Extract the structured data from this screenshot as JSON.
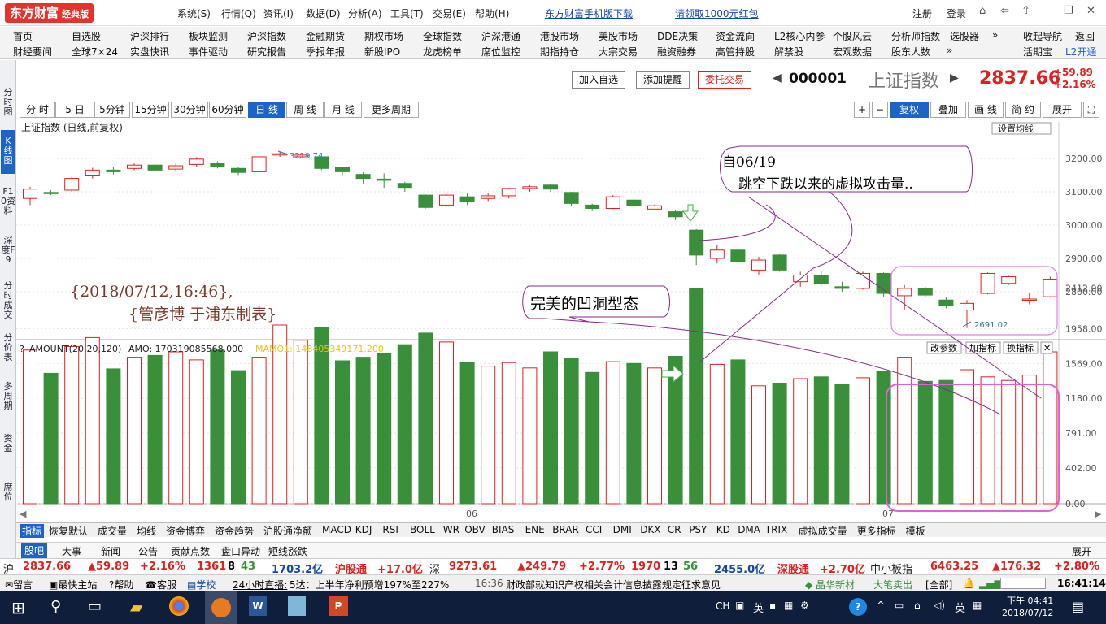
{
  "app": {
    "logo": "东方财富",
    "edition": "经典版"
  },
  "menu": [
    "系统(S)",
    "行情(Q)",
    "资讯(I)",
    "数据(D)",
    "分析(A)",
    "工具(T)",
    "交易(E)",
    "帮助(H)"
  ],
  "promos": [
    "东方财富手机版下载",
    "请领取1000元红包"
  ],
  "account": {
    "register": "注册",
    "login": "登录"
  },
  "nav_row1": [
    "首页",
    "自选股",
    "沪深排行",
    "板块监测",
    "沪深指数",
    "金融期货",
    "期权市场",
    "全球指数",
    "沪深港通",
    "港股市场",
    "美股市场",
    "DDE决策",
    "资金流向",
    "L2核心内参",
    "个股风云",
    "分析师指数",
    "选股器",
    "»",
    "收起导航",
    "返回"
  ],
  "nav_row2": [
    "财经要闻",
    "全球7×24",
    "实盘快讯",
    "事件驱动",
    "研究报告",
    "季报年报",
    "新股IPO",
    "龙虎榜单",
    "席位监控",
    "期指持仓",
    "大宗交易",
    "融资融券",
    "高管持股",
    "解禁股",
    "宏观数据",
    "股东人数",
    "»",
    "活期宝",
    "L2开通"
  ],
  "left_tabs": [
    "分时图",
    "K线图",
    "F10资料",
    "深度F9",
    "分时成交",
    "分价表",
    "多周期",
    "资金",
    "席位"
  ],
  "header_buttons": [
    "加入自选",
    "添加提醒",
    "委托交易"
  ],
  "symbol": {
    "code": "000001",
    "name": "上证指数",
    "price": "2837.66",
    "change": "+59.89",
    "pct": "+2.16%"
  },
  "periods": [
    "分 时",
    "5 日",
    "5分钟",
    "15分钟",
    "30分钟",
    "60分钟",
    "日 线",
    "周 线",
    "月 线",
    "更多周期"
  ],
  "active_period": "日 线",
  "chart_tools": [
    "+",
    "−",
    "复权",
    "叠加",
    "画 线",
    "简 约",
    "展开"
  ],
  "chart_title": "上证指数 (日线,前复权)",
  "ma_button": "设置均线",
  "vol_header": {
    "label": "AMOUNT(20,20,120)",
    "amo": "AMO: 170319085568.000",
    "mamo": "MAMO1: 148405349171.200"
  },
  "vol_buttons": [
    "改参数",
    "加指标",
    "换指标"
  ],
  "annotations": {
    "author_line1": "{2018/07/12,16:46},",
    "author_line2": "{管彦博 于浦东制表}",
    "gap_note_line1": "自06/19",
    "gap_note_line2": "跳空下跌以来的虚拟攻击量..",
    "pattern_note": "完美的凹洞型态",
    "high_label": "3219.74",
    "low_label": "2691.02"
  },
  "chart_data": {
    "type": "candlestick",
    "title": "上证指数 (日线,前复权)",
    "price_ticks": [
      3200,
      3100,
      3000,
      2900,
      2800
    ],
    "volume_ticks": [
      "2412.00",
      "1958.00",
      "1569.00",
      "1180.00",
      "791.00",
      "402.00",
      "0.00"
    ],
    "month_labels": [
      "06",
      "07"
    ],
    "candles": [
      {
        "o": 3080,
        "c": 3108,
        "h": 3115,
        "l": 3060,
        "v": 1720
      },
      {
        "o": 3098,
        "c": 3095,
        "h": 3105,
        "l": 3090,
        "v": 1460
      },
      {
        "o": 3105,
        "c": 3140,
        "h": 3145,
        "l": 3100,
        "v": 1760
      },
      {
        "o": 3150,
        "c": 3165,
        "h": 3172,
        "l": 3140,
        "v": 1860
      },
      {
        "o": 3165,
        "c": 3160,
        "h": 3175,
        "l": 3152,
        "v": 1510
      },
      {
        "o": 3170,
        "c": 3180,
        "h": 3185,
        "l": 3165,
        "v": 1640
      },
      {
        "o": 3180,
        "c": 3165,
        "h": 3184,
        "l": 3160,
        "v": 1660
      },
      {
        "o": 3168,
        "c": 3178,
        "h": 3185,
        "l": 3160,
        "v": 1700
      },
      {
        "o": 3182,
        "c": 3198,
        "h": 3204,
        "l": 3175,
        "v": 1610
      },
      {
        "o": 3185,
        "c": 3175,
        "h": 3192,
        "l": 3170,
        "v": 1720
      },
      {
        "o": 3170,
        "c": 3158,
        "h": 3174,
        "l": 3150,
        "v": 1490
      },
      {
        "o": 3160,
        "c": 3205,
        "h": 3208,
        "l": 3155,
        "v": 1640
      },
      {
        "o": 3212,
        "c": 3214,
        "h": 3219.74,
        "l": 3205,
        "v": 2000
      },
      {
        "o": 3205,
        "c": 3210,
        "h": 3215,
        "l": 3200,
        "v": 1830
      },
      {
        "o": 3205,
        "c": 3170,
        "h": 3208,
        "l": 3165,
        "v": 1970
      },
      {
        "o": 3172,
        "c": 3160,
        "h": 3175,
        "l": 3150,
        "v": 1600
      },
      {
        "o": 3152,
        "c": 3140,
        "h": 3158,
        "l": 3125,
        "v": 1640
      },
      {
        "o": 3138,
        "c": 3136,
        "h": 3155,
        "l": 3112,
        "v": 1680
      },
      {
        "o": 3125,
        "c": 3113,
        "h": 3130,
        "l": 3100,
        "v": 1780
      },
      {
        "o": 3090,
        "c": 3053,
        "h": 3092,
        "l": 3050,
        "v": 1910
      },
      {
        "o": 3060,
        "c": 3090,
        "h": 3092,
        "l": 3055,
        "v": 1810
      },
      {
        "o": 3085,
        "c": 3072,
        "h": 3095,
        "l": 3060,
        "v": 1580
      },
      {
        "o": 3080,
        "c": 3088,
        "h": 3095,
        "l": 3072,
        "v": 1540
      },
      {
        "o": 3088,
        "c": 3110,
        "h": 3112,
        "l": 3080,
        "v": 1580
      },
      {
        "o": 3110,
        "c": 3115,
        "h": 3120,
        "l": 3100,
        "v": 1520
      },
      {
        "o": 3120,
        "c": 3108,
        "h": 3125,
        "l": 3100,
        "v": 1700
      },
      {
        "o": 3098,
        "c": 3065,
        "h": 3100,
        "l": 3058,
        "v": 1630
      },
      {
        "o": 3060,
        "c": 3050,
        "h": 3064,
        "l": 3042,
        "v": 1470
      },
      {
        "o": 3050,
        "c": 3085,
        "h": 3090,
        "l": 3048,
        "v": 1590
      },
      {
        "o": 3075,
        "c": 3058,
        "h": 3082,
        "l": 3050,
        "v": 1570
      },
      {
        "o": 3048,
        "c": 3058,
        "h": 3062,
        "l": 3045,
        "v": 1520
      },
      {
        "o": 3040,
        "c": 3025,
        "h": 3045,
        "l": 3015,
        "v": 1650
      },
      {
        "o": 2985,
        "c": 2910,
        "h": 2988,
        "l": 2880,
        "v": 2412
      },
      {
        "o": 2900,
        "c": 2925,
        "h": 2940,
        "l": 2885,
        "v": 1560
      },
      {
        "o": 2925,
        "c": 2890,
        "h": 2940,
        "l": 2885,
        "v": 1610
      },
      {
        "o": 2865,
        "c": 2895,
        "h": 2905,
        "l": 2850,
        "v": 1320
      },
      {
        "o": 2910,
        "c": 2865,
        "h": 2912,
        "l": 2860,
        "v": 1350
      },
      {
        "o": 2830,
        "c": 2850,
        "h": 2860,
        "l": 2815,
        "v": 1400
      },
      {
        "o": 2850,
        "c": 2825,
        "h": 2862,
        "l": 2818,
        "v": 1420
      },
      {
        "o": 2815,
        "c": 2810,
        "h": 2830,
        "l": 2800,
        "v": 1340
      },
      {
        "o": 2810,
        "c": 2855,
        "h": 2860,
        "l": 2806,
        "v": 1410
      },
      {
        "o": 2855,
        "c": 2795,
        "h": 2858,
        "l": 2785,
        "v": 1480
      },
      {
        "o": 2788,
        "c": 2810,
        "h": 2820,
        "l": 2745,
        "v": 1640
      },
      {
        "o": 2810,
        "c": 2790,
        "h": 2815,
        "l": 2785,
        "v": 1370
      },
      {
        "o": 2775,
        "c": 2758,
        "h": 2785,
        "l": 2750,
        "v": 1380
      },
      {
        "o": 2745,
        "c": 2765,
        "h": 2775,
        "l": 2691.02,
        "v": 1500
      },
      {
        "o": 2795,
        "c": 2855,
        "h": 2858,
        "l": 2792,
        "v": 1420
      },
      {
        "o": 2825,
        "c": 2845,
        "h": 2848,
        "l": 2820,
        "v": 1380
      },
      {
        "o": 2778,
        "c": 2778,
        "h": 2795,
        "l": 2762,
        "v": 1440
      },
      {
        "o": 2785,
        "c": 2837.66,
        "h": 2845,
        "l": 2782,
        "v": 1700
      }
    ]
  },
  "indicators": [
    "指标",
    "恢复默认",
    "成交量",
    "均线",
    "资金博弈",
    "资金趋势",
    "沪股通净额",
    "MACD",
    "KDJ",
    "RSI",
    "BOLL",
    "WR",
    "OBV",
    "BIAS",
    "ENE",
    "BRAR",
    "CCI",
    "DMI",
    "DKX",
    "CR",
    "PSY",
    "KD",
    "DMA",
    "TRIX",
    "虚拟成交量",
    "更多指标",
    "模板"
  ],
  "active_indicator": "指标",
  "news_tabs": [
    "股吧",
    "大事",
    "新闻",
    "公告",
    "贡献点数",
    "盘口异动",
    "短线涨跌"
  ],
  "expand_label": "展开",
  "quotes": {
    "sh_tag": "沪",
    "sh_price": "2837.66",
    "sh_chg": "▲59.89",
    "sh_pct": "+2.16%",
    "sh_adv": "1361",
    "sh_flat": "8",
    "sh_dec": "43",
    "sh_amt": "1703.2亿",
    "hgt_label": "沪股通",
    "hgt_val": "+17.0亿",
    "sz_tag": "深",
    "sz_price": "9273.61",
    "sz_chg": "▲249.79",
    "sz_pct": "+2.77%",
    "sz_adv": "1970",
    "sz_flat": "13",
    "sz_dec": "56",
    "sz_amt": "2455.0亿",
    "sgt_label": "深股通",
    "sgt_val": "+2.70亿",
    "zxb_label": "中小板指",
    "zxb_price": "6463.25",
    "zxb_chg": "▲176.32",
    "zxb_pct": "+2.80%"
  },
  "ticker": {
    "msg": "留言",
    "site": "最快主站",
    "help": "帮助",
    "service": "客服",
    "school": "学校",
    "live": "24小时直播:",
    "headline1": "5达：上半年净利预增197%至227%",
    "time1": "16:36",
    "headline2": "财政部就知识产权相关会计信息披露规定征求意见",
    "stock": "晶华新材",
    "signal": "大笔卖出",
    "scope": "[全部]",
    "clock": "16:41:14"
  },
  "taskbar": {
    "lang": "CH",
    "ime": "英",
    "time": "下午 04:41",
    "date": "2018/07/12"
  },
  "colors": {
    "up": "#e02020",
    "down": "#3a8f3a",
    "accent": "#1e63c8",
    "annotation": "#8a2a8a",
    "box": "#e060e0"
  }
}
